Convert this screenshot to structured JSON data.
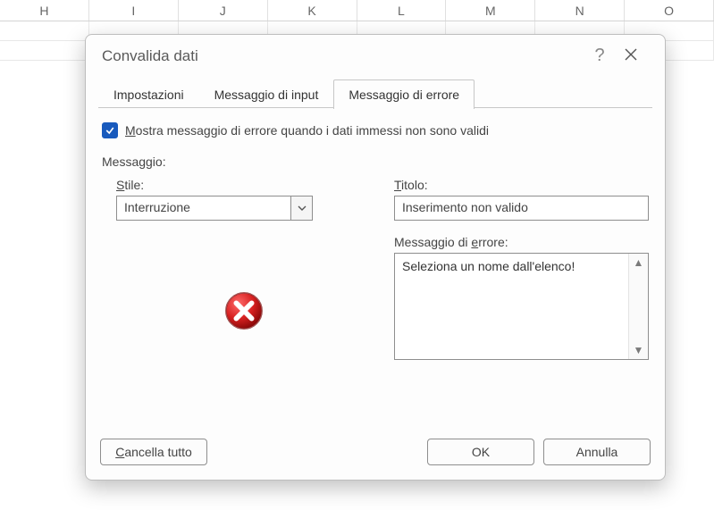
{
  "sheet": {
    "columns": [
      "H",
      "I",
      "J",
      "K",
      "L",
      "M",
      "N",
      "O"
    ]
  },
  "dialog": {
    "title": "Convalida dati",
    "tabs": {
      "settings": "Impostazioni",
      "input_message": "Messaggio di input",
      "error_message": "Messaggio di errore"
    },
    "active_tab": "error_message",
    "show_error_checkbox": {
      "checked": true,
      "prefix_underlined": "M",
      "label_rest": "ostra messaggio di errore quando i dati immessi non sono validi"
    },
    "section_label": "Messaggio:",
    "style": {
      "label_u": "S",
      "label_rest": "tile:",
      "value": "Interruzione"
    },
    "title_field": {
      "label_u": "T",
      "label_rest": "itolo:",
      "value": "Inserimento non valido"
    },
    "error_field": {
      "label_pre": "Messaggio di ",
      "label_u": "e",
      "label_post": "rrore:",
      "value": "Seleziona un nome dall'elenco!"
    },
    "buttons": {
      "clear_pre": "",
      "clear_u": "C",
      "clear_post": "ancella tutto",
      "ok": "OK",
      "cancel": "Annulla"
    }
  }
}
